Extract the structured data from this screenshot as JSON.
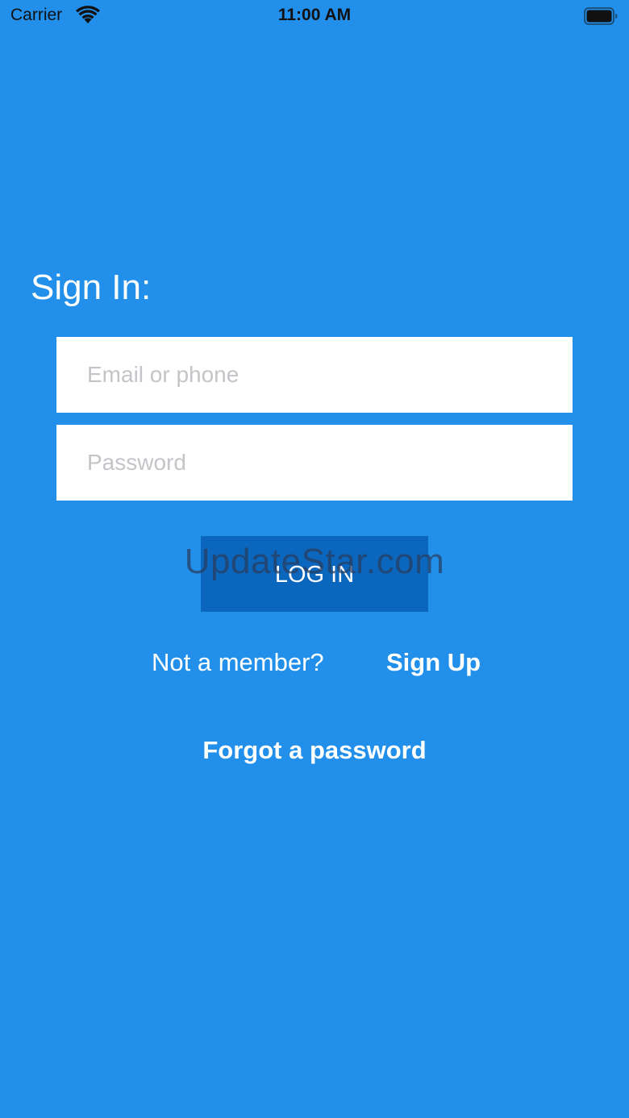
{
  "status_bar": {
    "carrier": "Carrier",
    "time": "11:00 AM",
    "wifi_icon": "wifi-icon",
    "battery_icon": "battery-icon"
  },
  "signin": {
    "title": "Sign In:",
    "email_placeholder": "Email or phone",
    "email_value": "",
    "password_placeholder": "Password",
    "password_value": "",
    "login_label": "LOG IN",
    "not_member_text": "Not a member?",
    "signup_label": "Sign Up",
    "forgot_label": "Forgot a password"
  },
  "watermark": "UpdateStar.com",
  "colors": {
    "background": "#2290EB",
    "button": "#0B66BD",
    "field": "#FFFFFF",
    "placeholder": "#C4C4C9"
  }
}
